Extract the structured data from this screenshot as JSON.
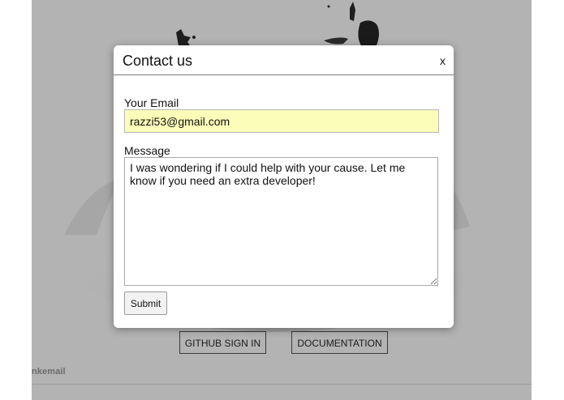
{
  "modal": {
    "title": "Contact us",
    "close_label": "x",
    "email_label": "Your Email",
    "email_value": "razzi53@gmail.com",
    "message_label": "Message",
    "message_value": "I was wondering if I could help with your cause. Let me know if you need an extra developer!",
    "submit_label": "Submit"
  },
  "background": {
    "github_button_label": "GITHUB SIGN IN",
    "documentation_button_label": "DOCUMENTATION",
    "footer_text": "nkemail"
  },
  "colors": {
    "overlay": "#b3b3b3",
    "email_autofill_bg": "#fcfdb8",
    "modal_bg": "#ffffff"
  }
}
